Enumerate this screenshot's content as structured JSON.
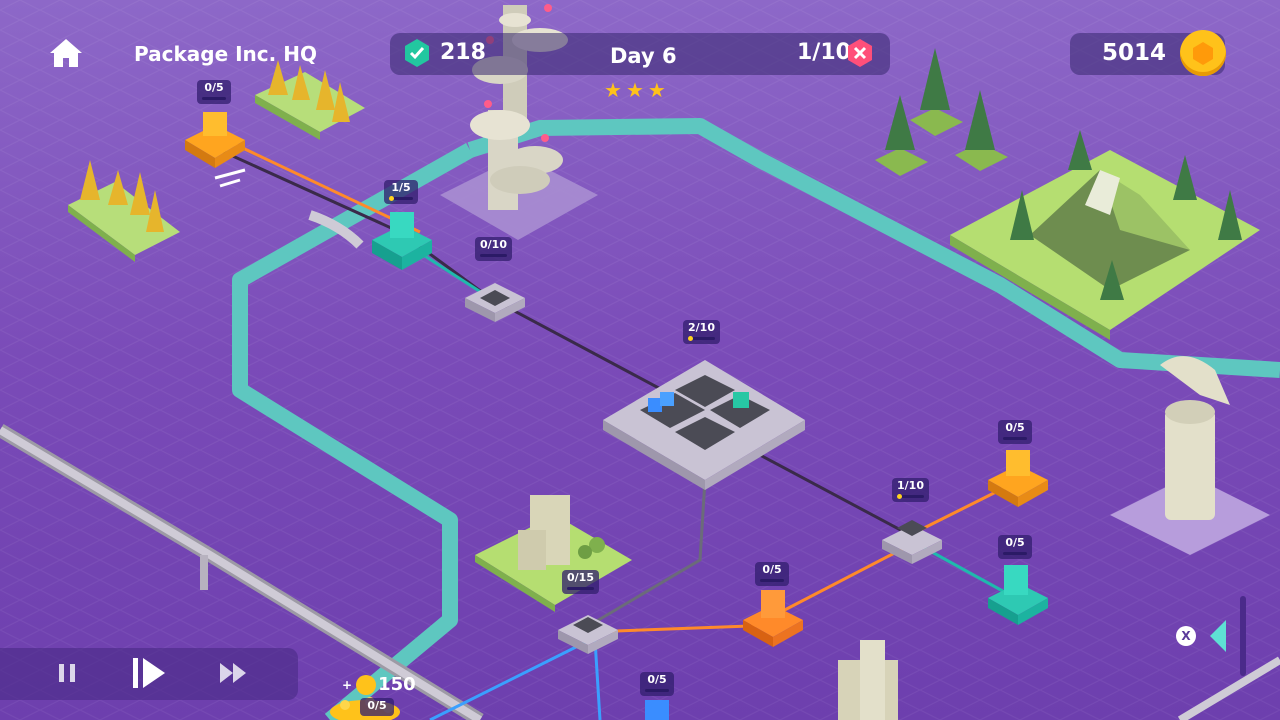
{
  "header": {
    "home_icon": "home-icon",
    "location_title": "Package Inc. HQ",
    "verified_count": "218",
    "day_label": "Day 6",
    "stars": 3,
    "failed_label": "1/10",
    "coins": "5014"
  },
  "nodes": {
    "top_left_depot": "0/5",
    "teal_depot_top": "1/5",
    "junction_top": "0/10",
    "central_hub": "2/10",
    "orange_depot_right": "0/5",
    "junction_right": "1/10",
    "teal_depot_right": "0/5",
    "castle_junction": "0/15",
    "orange_depot_bottom": "0/5",
    "blue_depot_bottom": "0/5",
    "coin_pile": "0/5"
  },
  "reward": {
    "label": "+",
    "amount": "150"
  },
  "controls": {
    "pause": "pause-icon",
    "play": "play-step-icon",
    "fast_forward": "fast-forward-icon",
    "close_label": "X"
  },
  "colors": {
    "ground": "#7a4bb8",
    "river": "#5ec7c0",
    "orange_route": "#ff8a2a",
    "teal_route": "#1fb9ad",
    "blue_route": "#3aa0ff",
    "coin": "#ffc21a"
  }
}
